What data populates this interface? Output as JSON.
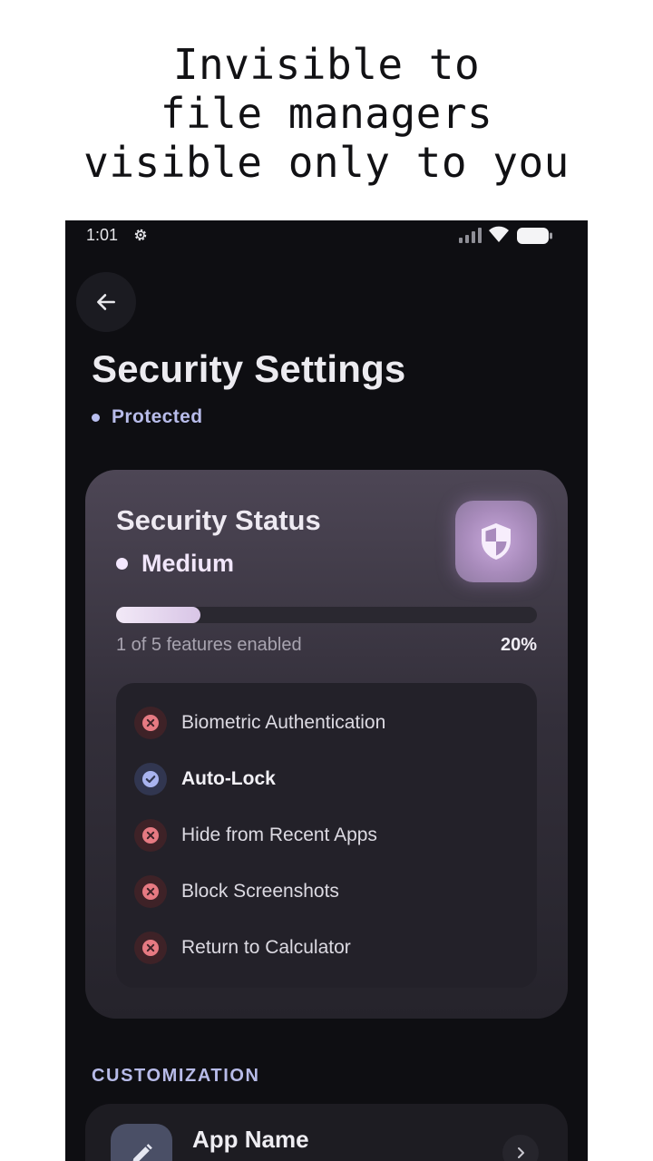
{
  "headline": {
    "line1": "Invisible to",
    "line2": "file managers",
    "line3": "visible only to you"
  },
  "status_bar": {
    "time": "1:01",
    "icons": [
      "gear-icon",
      "signal-icon",
      "wifi-icon",
      "battery-icon"
    ]
  },
  "header": {
    "back_icon": "arrow-left-icon",
    "title": "Security Settings",
    "status": "Protected"
  },
  "security_card": {
    "title": "Security Status",
    "level": "Medium",
    "shield_icon": "shield-icon",
    "progress_fraction": 0.2,
    "caption": "1 of 5 features enabled",
    "percent": "20%",
    "features": [
      {
        "label": "Biometric Authentication",
        "enabled": false
      },
      {
        "label": "Auto-Lock",
        "enabled": true
      },
      {
        "label": "Hide from Recent Apps",
        "enabled": false
      },
      {
        "label": "Block Screenshots",
        "enabled": false
      },
      {
        "label": "Return to Calculator",
        "enabled": false
      }
    ]
  },
  "customization": {
    "section_label": "CUSTOMIZATION",
    "app_name": {
      "title": "App Name",
      "icon": "pencil-icon",
      "chevron_icon": "chevron-right-icon"
    }
  },
  "colors": {
    "background": "#0e0e12",
    "accent": "#b8bcea",
    "disabled_icon": "#e67a82",
    "enabled_icon": "#a9b4f0"
  }
}
